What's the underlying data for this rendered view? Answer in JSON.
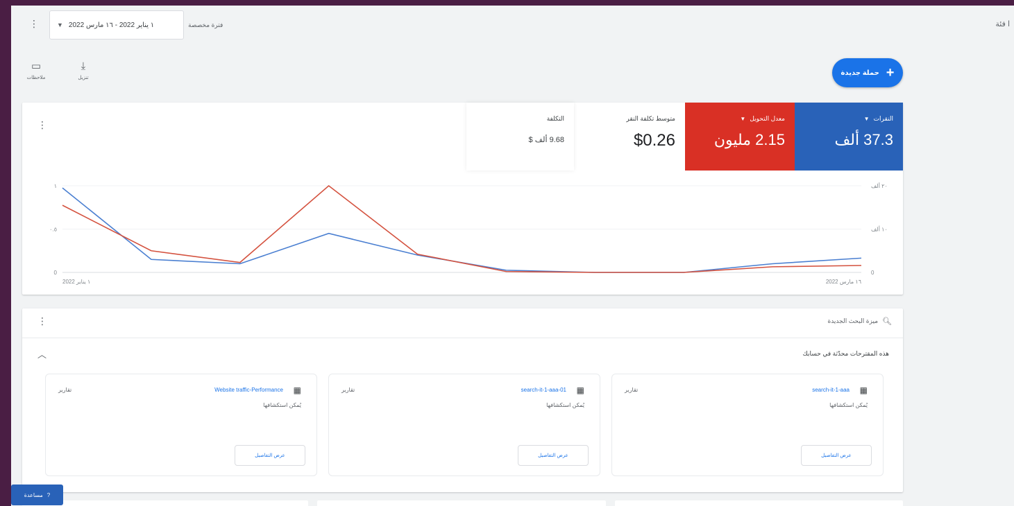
{
  "header": {
    "account_label": "ا فئة",
    "date_range": "١ يناير 2022 - ١٦ مارس 2022",
    "date_caption": "فترة مخصصة",
    "more_icon": "⋮"
  },
  "tools": {
    "feedback_label": "ملاحظات",
    "download_label": "تنزيل"
  },
  "new_campaign": {
    "label": "حملة جديدة",
    "icon": "plus-icon"
  },
  "metrics": {
    "clicks": {
      "label": "النقرات",
      "value": "37.3 ألف",
      "color": "#2962b8"
    },
    "conv_rate": {
      "label": "معدل التحويل",
      "value": "2.15 مليون",
      "color": "#d93025"
    },
    "cpc": {
      "label": "متوسط تكلفة النقر",
      "value": "$0.26"
    },
    "cost": {
      "label": "التكلفة",
      "value": "9.68 ألف $"
    }
  },
  "chart_data": {
    "type": "line",
    "x": [
      0,
      1,
      2,
      3,
      4,
      5,
      6,
      7,
      8,
      9
    ],
    "x_tick_labels": [
      "١ يناير 2022",
      "١٦ مارس 2022"
    ],
    "y_left_ticks": [
      "0",
      "٠.٥",
      "١"
    ],
    "y_right_ticks": [
      "0",
      "١٠ ألف",
      "٢٠ ألف"
    ],
    "series": [
      {
        "color": "#4a7fd1",
        "values": [
          19.5,
          3,
          2,
          9,
          4,
          0.5,
          0,
          0,
          2,
          3.3
        ]
      },
      {
        "color": "#d4523f",
        "values": [
          15.5,
          5,
          2.3,
          20,
          4.2,
          0.2,
          0,
          0,
          1.3,
          1.6
        ]
      }
    ]
  },
  "recommendations": {
    "header": "ميزة البحث الجديدة",
    "subtitle": "هذه المقترحات محدّثة في حسابك",
    "cards": [
      {
        "title": "search-it-1-aaa",
        "subtitle": "يُمكن استكشافها",
        "type": "تقارير",
        "button": "عرض التفاصيل"
      },
      {
        "title": "search-it-1-aaa-01",
        "subtitle": "يُمكن استكشافها",
        "type": "تقارير",
        "button": "عرض التفاصيل"
      },
      {
        "title": "Website traffic-Performance",
        "subtitle": "يُمكن استكشافها",
        "type": "تقارير",
        "button": "عرض التفاصيل"
      }
    ]
  },
  "help": {
    "label": "مساعدة",
    "icon": "help-icon"
  }
}
